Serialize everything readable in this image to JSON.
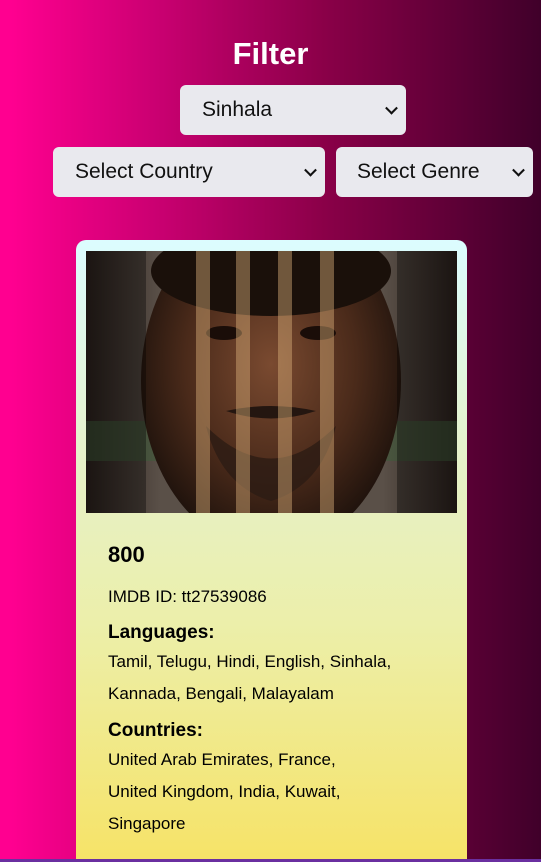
{
  "filter": {
    "title": "Filter",
    "language_select": {
      "selected": "Sinhala"
    },
    "country_select": {
      "selected": "Select Country"
    },
    "genre_select": {
      "selected": "Select Genre"
    }
  },
  "movie": {
    "title": "800",
    "imdb_label": "IMDB ID: tt27539086",
    "languages_heading": "Languages:",
    "languages_line1": "Tamil, Telugu, Hindi, English, Sinhala,",
    "languages_line2": "Kannada, Bengali, Malayalam",
    "countries_heading": "Countries:",
    "countries_line1": "United Arab Emirates, France,",
    "countries_line2": "United Kingdom, India, Kuwait,",
    "countries_line3": "Singapore"
  }
}
